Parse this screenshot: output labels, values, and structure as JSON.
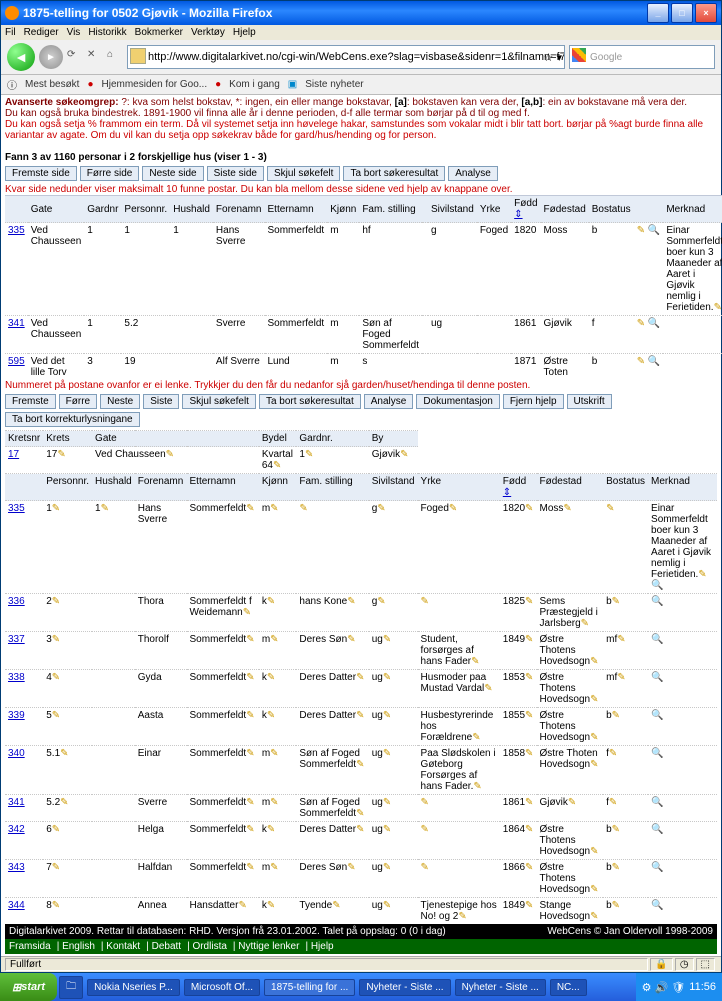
{
  "window": {
    "title": "1875-telling for 0502 Gjøvik - Mozilla Firefox"
  },
  "menu": [
    "Fil",
    "Rediger",
    "Vis",
    "Historikk",
    "Bokmerker",
    "Verktøy",
    "Hjelp"
  ],
  "url": "http://www.digitalarkivet.no/cgi-win/WebCens.exe?slag=visbase&sidenr=1&filnamn=f70502&gardpostnr=17&personpostnr=335&bilyard=true",
  "search_placeholder": "Google",
  "bookmarks": {
    "label": "Mest besøkt",
    "items": [
      "Hjemmesiden for Goo...",
      "Kom i gang",
      "Siste nyheter"
    ]
  },
  "intro": {
    "line1a": "Avanserte søkeomgrep:",
    "line1b": "?: kva som helst bokstav, *: ingen, ein eller mange bokstavar,",
    "line1c": "[a]",
    "line1d": ": bokstaven kan vera der,",
    "line1e": "[a,b]",
    "line1f": ": ein av bokstavane må vera der.",
    "line2": "Du kan også bruka bindestrek. 1891-1900 vil finna alle år i denne perioden, d-f alle termar som børjar på d til og med f.",
    "line3": "Du kan også setja % frammom ein term. Då vil systemet setja inn høvelege hakar, samstundes som vokalar midt i blir tatt bort. børjar på %agt burde finna alle variantar av agate. Om du vil kan du setja opp søkekrav både for gard/hus/hending og for person."
  },
  "found": {
    "a": "Fann 3 av 1160 personar i 2 forskjellige hus (viser 1 - 3)"
  },
  "buttons1": [
    "Fremste side",
    "Førre side",
    "Neste side",
    "Siste side",
    "Skjul søkefelt",
    "Ta bort søkeresultat",
    "Analyse"
  ],
  "tip": "Kvar side nedunder viser maksimalt 10 funne postar. Du kan bla mellom desse sidene ved hjelp av knappane over.",
  "cols1": [
    "Gate",
    "Gardnr",
    "Personnr.",
    "Hushald",
    "Forenamn",
    "Etternamn",
    "Kjønn",
    "Fam. stilling",
    "Sivilstand",
    "Yrke",
    "Fødd",
    "Fødestad",
    "Bostatus",
    "Merknad"
  ],
  "rows1": [
    {
      "n": "335",
      "c": [
        "Ved Chausseen",
        "1",
        "1",
        "1",
        "Hans Sverre",
        "Sommerfeldt",
        "m",
        "hf",
        "g",
        "Foged",
        "1820",
        "Moss",
        "b",
        "Einar Sommerfeldt boer kun 3 Maaneder af Aaret i Gjøvik nemlig i Ferietiden."
      ]
    },
    {
      "n": "341",
      "c": [
        "Ved Chausseen",
        "1",
        "5.2",
        "",
        "Sverre",
        "Sommerfeldt",
        "m",
        "Søn af Foged Sommerfeldt",
        "ug",
        "",
        "1861",
        "Gjøvik",
        "f",
        ""
      ]
    },
    {
      "n": "595",
      "c": [
        "Ved det lille Torv",
        "3",
        "19",
        "",
        "Alf Sverre",
        "Lund",
        "m",
        "s",
        "",
        "",
        "1871",
        "Østre Toten",
        "b",
        ""
      ]
    }
  ],
  "note": "Nummeret på postane ovanfor er ei lenke. Trykkjer du den får du nedanfor sjå garden/huset/hendinga til denne posten.",
  "buttons2": [
    "Fremste",
    "Førre",
    "Neste",
    "Siste",
    "Skjul søkefelt",
    "Ta bort søkeresultat",
    "Analyse",
    "Dokumentasjon",
    "Fjern hjelp",
    "Utskrift",
    "Ta bort korrekturlysningane"
  ],
  "sub": {
    "labels": [
      "Kretsnr",
      "Krets",
      "Gate",
      "Bydel",
      "Gardnr.",
      "By"
    ],
    "vals": [
      "17",
      "17",
      "Ved Chausseen",
      "Kvartal 64",
      "1",
      "Gjøvik"
    ]
  },
  "cols2": [
    "Personnr.",
    "Hushald",
    "Forenamn",
    "Etternamn",
    "Kjønn",
    "Fam. stilling",
    "Sivilstand",
    "Yrke",
    "Fødd",
    "Fødestad",
    "Bostatus",
    "Merknad"
  ],
  "rows2": [
    {
      "n": "335",
      "c": [
        "1",
        "1",
        "Hans Sverre",
        "Sommerfeldt",
        "m",
        "",
        "g",
        "Foged",
        "1820",
        "Moss",
        "",
        "Einar Sommerfeldt boer kun 3 Maaneder af Aaret i Gjøvik nemlig i Ferietiden."
      ]
    },
    {
      "n": "336",
      "c": [
        "2",
        "",
        "Thora",
        "Sommerfeldt f Weidemann",
        "k",
        "hans Kone",
        "g",
        "",
        "1825",
        "Sems Præstegjeld i Jarlsberg",
        "b",
        ""
      ]
    },
    {
      "n": "337",
      "c": [
        "3",
        "",
        "Thorolf",
        "Sommerfeldt",
        "m",
        "Deres Søn",
        "ug",
        "Student, forsørges af hans Fader",
        "1849",
        "Østre Thotens Hovedsogn",
        "mf",
        ""
      ]
    },
    {
      "n": "338",
      "c": [
        "4",
        "",
        "Gyda",
        "Sommerfeldt",
        "k",
        "Deres Datter",
        "ug",
        "Husmoder paa Mustad Vardal",
        "1853",
        "Østre Thotens Hovedsogn",
        "mf",
        ""
      ]
    },
    {
      "n": "339",
      "c": [
        "5",
        "",
        "Aasta",
        "Sommerfeldt",
        "k",
        "Deres Datter",
        "ug",
        "Husbestyrerinde hos Forældrene",
        "1855",
        "Østre Thotens Hovedsogn",
        "b",
        ""
      ]
    },
    {
      "n": "340",
      "c": [
        "5.1",
        "",
        "Einar",
        "Sommerfeldt",
        "m",
        "Søn af Foged Sommerfeldt",
        "ug",
        "Paa Slødskolen i Gøteborg Forsørges af hans Fader.",
        "1858",
        "Østre Thoten Hovedsogn",
        "f",
        ""
      ]
    },
    {
      "n": "341",
      "c": [
        "5.2",
        "",
        "Sverre",
        "Sommerfeldt",
        "m",
        "Søn af Foged Sommerfeldt",
        "ug",
        "",
        "1861",
        "Gjøvik",
        "f",
        ""
      ]
    },
    {
      "n": "342",
      "c": [
        "6",
        "",
        "Helga",
        "Sommerfeldt",
        "k",
        "Deres Datter",
        "ug",
        "",
        "1864",
        "Østre Thotens Hovedsogn",
        "b",
        ""
      ]
    },
    {
      "n": "343",
      "c": [
        "7",
        "",
        "Halfdan",
        "Sommerfeldt",
        "m",
        "Deres Søn",
        "ug",
        "",
        "1866",
        "Østre Thotens Hovedsogn",
        "b",
        ""
      ]
    },
    {
      "n": "344",
      "c": [
        "8",
        "",
        "Annea",
        "Hansdatter",
        "k",
        "Tyende",
        "ug",
        "Tjenestepige hos No! og 2",
        "1849",
        "Stange Hovedsogn",
        "b",
        ""
      ]
    }
  ],
  "footer": {
    "left": "Digitalarkivet 2009. Rettar til databasen: RHD. Versjon frå 23.01.2002. Talet på oppslag: 0 (0 i dag)",
    "right": "WebCens © Jan Oldervoll 1998-2009"
  },
  "greenlinks": [
    "Framsida",
    "English",
    "Kontakt",
    "Debatt",
    "Ordlista",
    "Nyttige lenker",
    "Hjelp"
  ],
  "status": "Fullført",
  "start": "start",
  "tasks": [
    "",
    "Nokia Nseries P...",
    "Microsoft Of...",
    "1875-telling for ...",
    "Nyheter - Siste ...",
    "Nyheter - Siste ...",
    "NC..."
  ],
  "clock": "11:56"
}
